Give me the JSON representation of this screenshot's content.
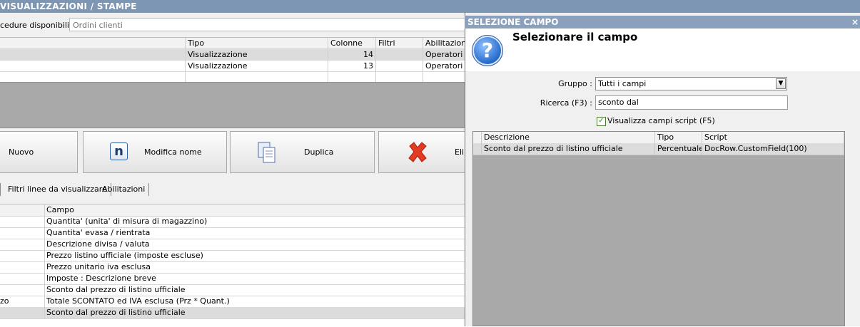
{
  "window": {
    "title": "VISUALIZZAZIONI / STAMPE"
  },
  "procedures": {
    "label": "cedure disponibili :",
    "value": "Ordini clienti"
  },
  "top_grid": {
    "headers": [
      "Tipo",
      "Colonne",
      "Filtri",
      "Abilitazioni"
    ],
    "rows": [
      [
        "Visualizzazione",
        "14",
        "",
        "Operatori"
      ],
      [
        "Visualizzazione",
        "13",
        "",
        "Operatori"
      ]
    ]
  },
  "buttons": {
    "new": "Nuovo",
    "rename": "Modifica nome",
    "rename_icon_letter": "n",
    "duplicate": "Duplica",
    "delete_partial": "Elir"
  },
  "tabs": [
    "Filtri linee da visualizzare",
    "Abilitazioni"
  ],
  "bottom_grid": {
    "header": "Campo",
    "rows": [
      {
        "left": "",
        "campo": "Quantita' (unita' di misura di magazzino)"
      },
      {
        "left": "",
        "campo": "Quantita' evasa / rientrata"
      },
      {
        "left": "",
        "campo": "Descrizione divisa / valuta"
      },
      {
        "left": "",
        "campo": "Prezzo listino ufficiale (imposte escluse)"
      },
      {
        "left": "",
        "campo": "Prezzo unitario iva esclusa"
      },
      {
        "left": "",
        "campo": "Imposte : Descrizione breve"
      },
      {
        "left": "",
        "campo": "Sconto dal prezzo di listino ufficiale"
      },
      {
        "left": "zo",
        "campo": "Totale SCONTATO ed IVA esclusa (Prz * Quant.)"
      },
      {
        "left": "",
        "campo": "Sconto dal prezzo di listino ufficiale"
      }
    ]
  },
  "dialog": {
    "title": "SELEZIONE CAMPO",
    "close": "×",
    "heading": "Selezionare il campo",
    "group_label": "Gruppo :",
    "group_value": "Tutti i campi",
    "search_label": "Ricerca (F3) :",
    "search_value": "sconto dal",
    "script_checkbox_label": "Visualizza campi script (F5)",
    "script_checkbox_checked": true,
    "grid_headers": [
      "Descrizione",
      "Tipo",
      "Script"
    ],
    "grid_rows": [
      [
        "Sconto dal prezzo di listino ufficiale",
        "Percentuale",
        "DocRow.CustomField(100)"
      ]
    ]
  },
  "colors": {
    "title_bar": "#7d96b4",
    "dialog_title": "#8ba0bd",
    "selected_row": "#dcdcdc",
    "empty_area": "#a9a9a9"
  }
}
